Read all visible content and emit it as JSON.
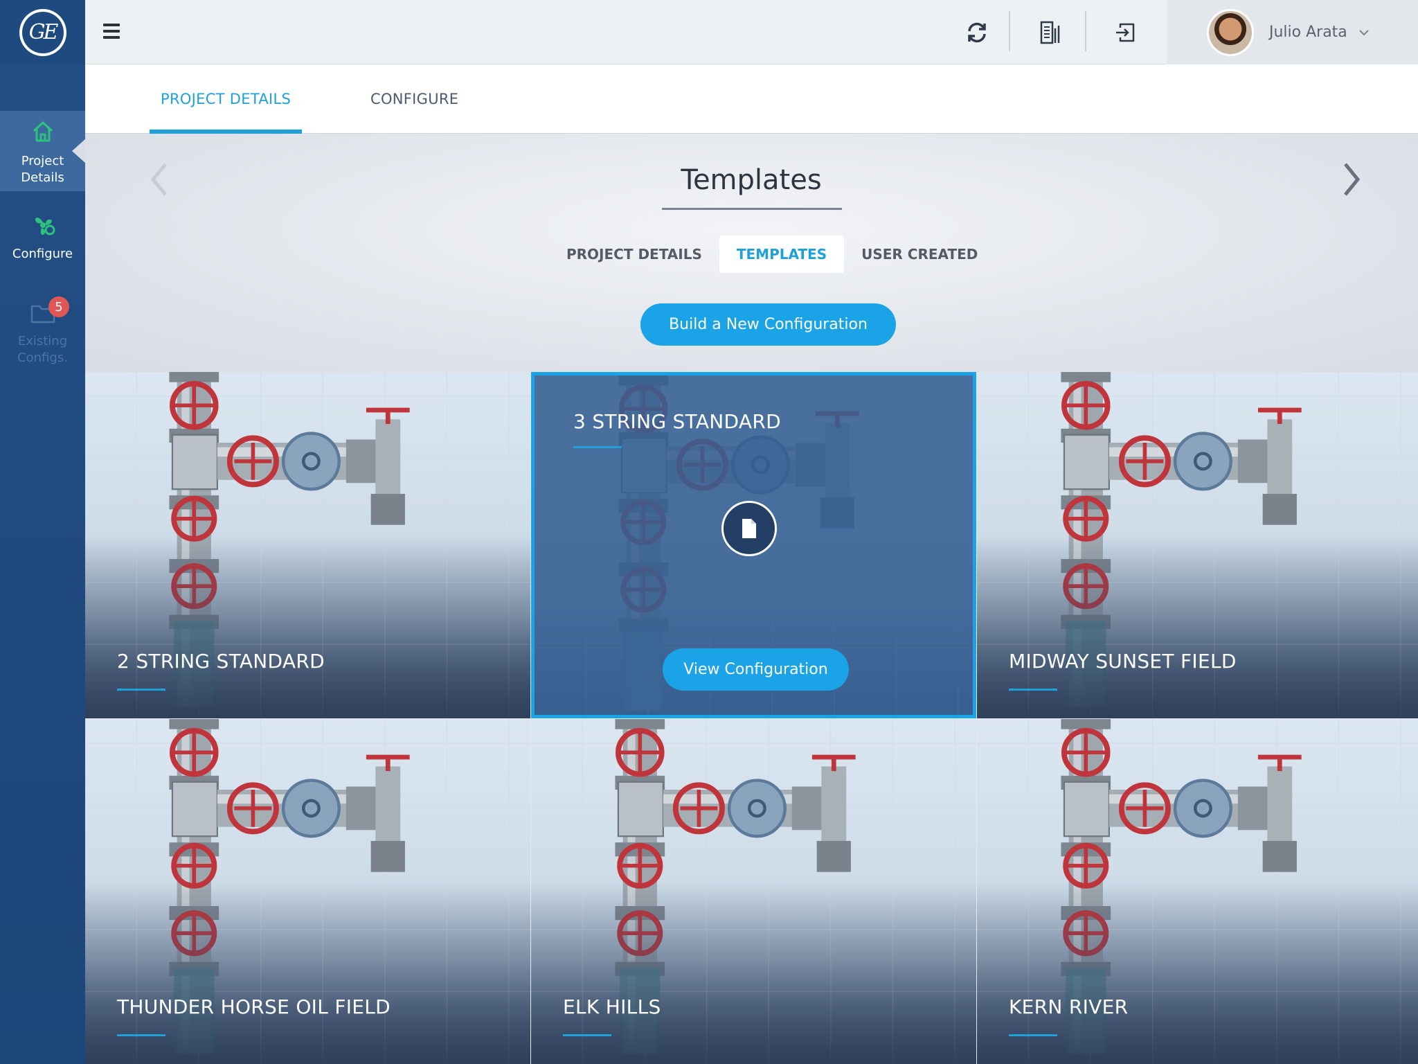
{
  "app": {
    "logo_text": "GE"
  },
  "sidebar": {
    "items": [
      {
        "label_line1": "Project",
        "label_line2": "Details",
        "icon": "home-icon",
        "active": true
      },
      {
        "label_line1": "Configure",
        "label_line2": "",
        "icon": "fan-icon",
        "active": false
      },
      {
        "label_line1": "Existing",
        "label_line2": "Configs.",
        "icon": "folder-icon",
        "active": false,
        "badge": "5"
      }
    ]
  },
  "topbar": {
    "icons": [
      "sync-icon",
      "report-icon",
      "logout-icon"
    ],
    "user": {
      "name": "Julio Arata"
    }
  },
  "subnav": {
    "tabs": [
      {
        "label": "PROJECT DETAILS",
        "active": true
      },
      {
        "label": "CONFIGURE",
        "active": false
      }
    ]
  },
  "hero": {
    "title": "Templates",
    "pills": [
      {
        "label": "PROJECT DETAILS",
        "active": false
      },
      {
        "label": "TEMPLATES",
        "active": true
      },
      {
        "label": "USER CREATED",
        "active": false
      }
    ],
    "primary_button": "Build a New Configuration"
  },
  "cards": [
    {
      "title": "2 STRING STANDARD"
    },
    {
      "title": "3 STRING STANDARD",
      "selected": true,
      "action": "View Configuration"
    },
    {
      "title": "MIDWAY SUNSET FIELD"
    },
    {
      "title": "THUNDER HORSE OIL FIELD"
    },
    {
      "title": "ELK HILLS"
    },
    {
      "title": "KERN RIVER"
    }
  ],
  "colors": {
    "accent": "#1ea0d9",
    "sidebar": "#234f86",
    "badge": "#e05555",
    "valve_red": "#c0343b"
  }
}
